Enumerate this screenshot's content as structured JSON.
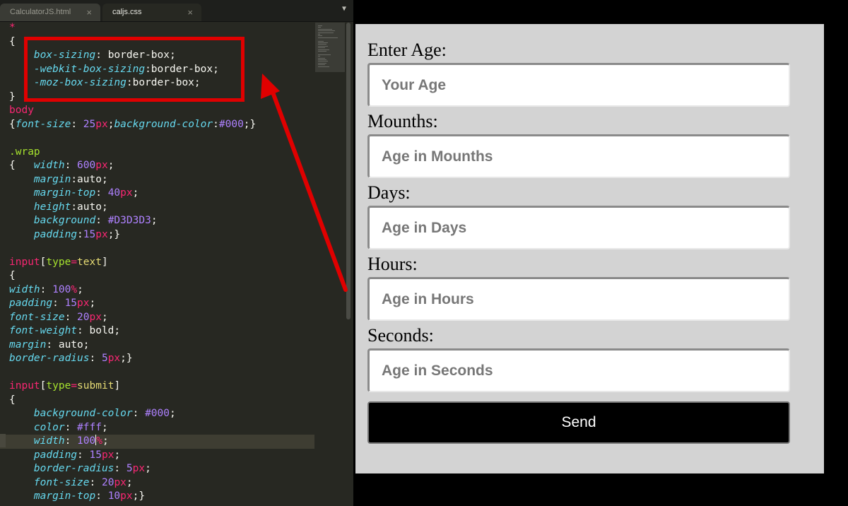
{
  "editor": {
    "tabs": [
      {
        "label": "CalculatorJS.html",
        "close": "×",
        "active": false
      },
      {
        "label": "caljs.css",
        "close": "×",
        "active": true
      }
    ],
    "tab_menu_icon": "dropdown-triangle-icon",
    "code_lines": [
      [
        [
          "*",
          "sel"
        ]
      ],
      [
        [
          "{",
          "punc"
        ]
      ],
      [
        [
          "    ",
          "val"
        ],
        [
          "box-sizing",
          "prop"
        ],
        [
          ": border-box;",
          "val"
        ]
      ],
      [
        [
          "    ",
          "val"
        ],
        [
          "-webkit-box-sizing",
          "prop"
        ],
        [
          ":border-box;",
          "val"
        ]
      ],
      [
        [
          "    ",
          "val"
        ],
        [
          "-moz-box-sizing",
          "prop"
        ],
        [
          ":border-box;",
          "val"
        ]
      ],
      [
        [
          "}",
          "punc"
        ]
      ],
      [
        [
          "body",
          "sel"
        ]
      ],
      [
        [
          "{",
          "punc"
        ],
        [
          "font-size",
          "prop"
        ],
        [
          ": ",
          "val"
        ],
        [
          "25",
          "num"
        ],
        [
          "px",
          "unit"
        ],
        [
          ";",
          "val"
        ],
        [
          "background-color",
          "prop"
        ],
        [
          ":",
          "val"
        ],
        [
          "#000",
          "num"
        ],
        [
          ";}",
          "val"
        ]
      ],
      [],
      [
        [
          ".wrap",
          "class"
        ]
      ],
      [
        [
          "{   ",
          "punc"
        ],
        [
          "width",
          "prop"
        ],
        [
          ": ",
          "val"
        ],
        [
          "600",
          "num"
        ],
        [
          "px",
          "unit"
        ],
        [
          ";",
          "val"
        ]
      ],
      [
        [
          "    ",
          "val"
        ],
        [
          "margin",
          "prop"
        ],
        [
          ":auto;",
          "val"
        ]
      ],
      [
        [
          "    ",
          "val"
        ],
        [
          "margin-top",
          "prop"
        ],
        [
          ": ",
          "val"
        ],
        [
          "40",
          "num"
        ],
        [
          "px",
          "unit"
        ],
        [
          ";",
          "val"
        ]
      ],
      [
        [
          "    ",
          "val"
        ],
        [
          "height",
          "prop"
        ],
        [
          ":auto;",
          "val"
        ]
      ],
      [
        [
          "    ",
          "val"
        ],
        [
          "background",
          "prop"
        ],
        [
          ": ",
          "val"
        ],
        [
          "#D3D3D3",
          "num"
        ],
        [
          ";",
          "val"
        ]
      ],
      [
        [
          "    ",
          "val"
        ],
        [
          "padding",
          "prop"
        ],
        [
          ":",
          "val"
        ],
        [
          "15",
          "num"
        ],
        [
          "px",
          "unit"
        ],
        [
          ";}",
          "val"
        ]
      ],
      [],
      [
        [
          "input",
          "sel"
        ],
        [
          "[",
          "val"
        ],
        [
          "type",
          "class"
        ],
        [
          "=",
          "sel"
        ],
        [
          "text",
          "attrv"
        ],
        [
          "]",
          "val"
        ]
      ],
      [
        [
          "{",
          "punc"
        ]
      ],
      [
        [
          "width",
          "prop"
        ],
        [
          ": ",
          "val"
        ],
        [
          "100",
          "num"
        ],
        [
          "%",
          "unit"
        ],
        [
          ";",
          "val"
        ]
      ],
      [
        [
          "padding",
          "prop"
        ],
        [
          ": ",
          "val"
        ],
        [
          "15",
          "num"
        ],
        [
          "px",
          "unit"
        ],
        [
          ";",
          "val"
        ]
      ],
      [
        [
          "font-size",
          "prop"
        ],
        [
          ": ",
          "val"
        ],
        [
          "20",
          "num"
        ],
        [
          "px",
          "unit"
        ],
        [
          ";",
          "val"
        ]
      ],
      [
        [
          "font-weight",
          "prop"
        ],
        [
          ": bold;",
          "val"
        ]
      ],
      [
        [
          "margin",
          "prop"
        ],
        [
          ": auto;",
          "val"
        ]
      ],
      [
        [
          "border-radius",
          "prop"
        ],
        [
          ": ",
          "val"
        ],
        [
          "5",
          "num"
        ],
        [
          "px",
          "unit"
        ],
        [
          ";}",
          "val"
        ]
      ],
      [],
      [
        [
          "input",
          "sel"
        ],
        [
          "[",
          "val"
        ],
        [
          "type",
          "class"
        ],
        [
          "=",
          "sel"
        ],
        [
          "submit",
          "attrv"
        ],
        [
          "]",
          "val"
        ]
      ],
      [
        [
          "{",
          "punc"
        ]
      ],
      [
        [
          "    ",
          "val"
        ],
        [
          "background-color",
          "prop"
        ],
        [
          ": ",
          "val"
        ],
        [
          "#000",
          "num"
        ],
        [
          ";",
          "val"
        ]
      ],
      [
        [
          "    ",
          "val"
        ],
        [
          "color",
          "prop"
        ],
        [
          ": ",
          "val"
        ],
        [
          "#fff",
          "num"
        ],
        [
          ";",
          "val"
        ]
      ],
      [
        [
          "    ",
          "val"
        ],
        [
          "width",
          "prop"
        ],
        [
          ": ",
          "val"
        ],
        [
          "100",
          "num"
        ],
        [
          "|",
          "caret"
        ],
        [
          "%",
          "unit"
        ],
        [
          ";",
          "val"
        ]
      ],
      [
        [
          "    ",
          "val"
        ],
        [
          "padding",
          "prop"
        ],
        [
          ": ",
          "val"
        ],
        [
          "15",
          "num"
        ],
        [
          "px",
          "unit"
        ],
        [
          ";",
          "val"
        ]
      ],
      [
        [
          "    ",
          "val"
        ],
        [
          "border-radius",
          "prop"
        ],
        [
          ": ",
          "val"
        ],
        [
          "5",
          "num"
        ],
        [
          "px",
          "unit"
        ],
        [
          ";",
          "val"
        ]
      ],
      [
        [
          "    ",
          "val"
        ],
        [
          "font-size",
          "prop"
        ],
        [
          ": ",
          "val"
        ],
        [
          "20",
          "num"
        ],
        [
          "px",
          "unit"
        ],
        [
          ";",
          "val"
        ]
      ],
      [
        [
          "    ",
          "val"
        ],
        [
          "margin-top",
          "prop"
        ],
        [
          ": ",
          "val"
        ],
        [
          "10",
          "num"
        ],
        [
          "px",
          "unit"
        ],
        [
          ";}",
          "val"
        ]
      ]
    ],
    "highlighted_line": 30
  },
  "annotation": {
    "box_color": "#e00000",
    "arrow_color": "#e00000"
  },
  "preview": {
    "background": "#d3d3d3",
    "fields": [
      {
        "label": "Enter Age:",
        "placeholder": "Your Age",
        "value": ""
      },
      {
        "label": "Mounths:",
        "placeholder": "Age in Mounths",
        "value": ""
      },
      {
        "label": "Days:",
        "placeholder": "Age in Days",
        "value": ""
      },
      {
        "label": "Hours:",
        "placeholder": "Age in Hours",
        "value": ""
      },
      {
        "label": "Seconds:",
        "placeholder": "Age in Seconds",
        "value": ""
      }
    ],
    "send_label": "Send"
  }
}
